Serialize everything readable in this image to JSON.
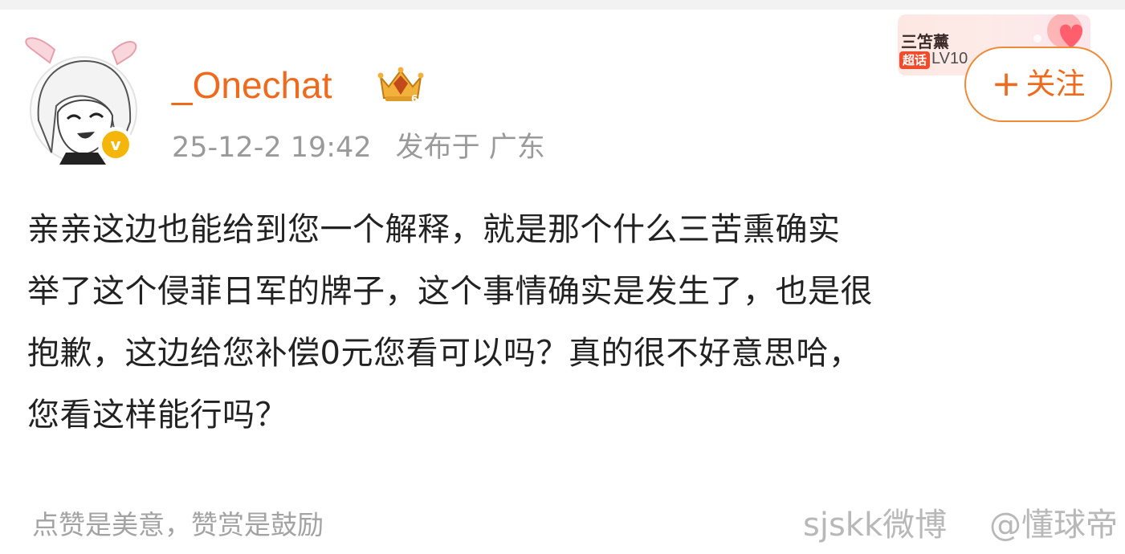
{
  "post": {
    "username": "_Onechat",
    "timestamp": "25-12-2 19:42",
    "location": "发布于 广东",
    "verified_icon": "v",
    "lines": [
      "亲亲这边也能给到您一个解释，就是那个什么三苦熏确实",
      "举了这个侵菲日军的牌子，这个事情确实是发生了，也是很",
      "抱歉，这边给您补偿0元您看可以吗？真的很不好意思哈，",
      "您看这样能行吗？"
    ]
  },
  "topic_card": {
    "name": "三笘薰",
    "tag": "超话",
    "level": "LV10"
  },
  "follow_button": {
    "plus": "+",
    "label": "关注"
  },
  "footer": {
    "hint": "点赞是美意，赞赏是鼓励"
  },
  "watermark": {
    "text_a": "sjskk微博",
    "text_b": "@懂球帝"
  },
  "colors": {
    "accent": "#ef6a1c",
    "follow_border": "#f08a37",
    "meta_text": "#9a9a9a",
    "body_text": "#222222",
    "badge": "#f5b60c"
  }
}
